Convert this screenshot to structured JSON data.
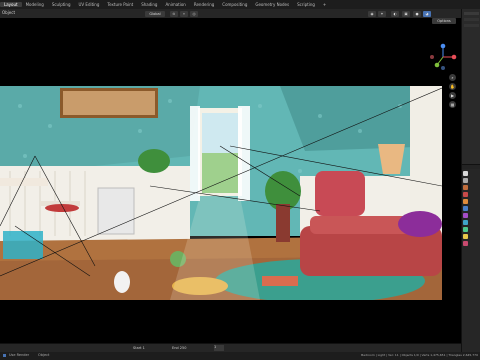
{
  "topbar": {
    "tabs": [
      "Layout",
      "Modeling",
      "Sculpting",
      "UV Editing",
      "Texture Paint",
      "Shading",
      "Animation",
      "Rendering",
      "Compositing",
      "Geometry Nodes",
      "Scripting",
      "+"
    ],
    "active_index": 0
  },
  "header": {
    "view_label": "Object",
    "orientation_label": "Global",
    "options_label": "Options"
  },
  "timeline": {
    "start_label": "Start 1",
    "end_label": "End 250",
    "frame": "1"
  },
  "statusbar": {
    "left": "Use Render",
    "middle": "Object",
    "right": "Bedroom | Light | Ver: 11 | Objects 1/0 | Verts 1,475,651 | Triangles 2,645,770"
  },
  "colors": {
    "wall": "#62b7b5",
    "floor": "#b0723f",
    "sofa": "#b84546",
    "rug": "#3b9f8e",
    "pillow": "#8c2d9a",
    "cushion": "#e6b34b"
  },
  "icons": [
    "gear-icon",
    "zoom-icon",
    "hand-icon",
    "camera-icon",
    "grid-icon",
    "viewport-gizmo",
    "render-tab-icon",
    "output-tab-icon",
    "scene-tab-icon",
    "world-tab-icon",
    "object-tab-icon",
    "modifier-tab-icon",
    "particle-tab-icon",
    "physics-tab-icon",
    "constraint-tab-icon",
    "data-tab-icon",
    "material-tab-icon"
  ]
}
